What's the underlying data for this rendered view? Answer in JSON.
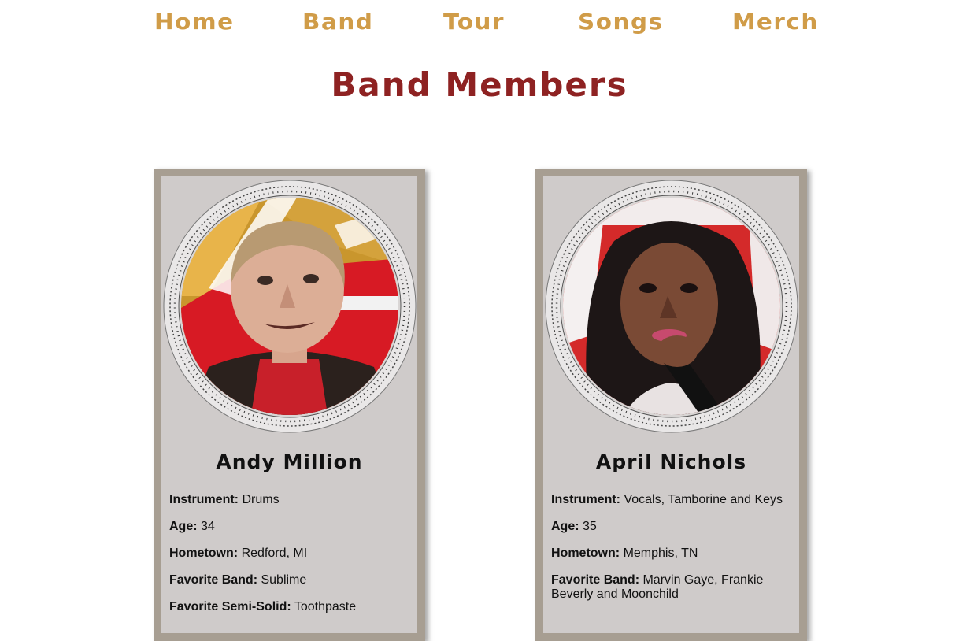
{
  "colors": {
    "nav": "#d09c48",
    "title": "#8e2222",
    "card_frame": "#a79e92",
    "card_bg": "#cfcbca"
  },
  "nav": {
    "items": [
      {
        "label": "Home"
      },
      {
        "label": "Band"
      },
      {
        "label": "Tour"
      },
      {
        "label": "Songs"
      },
      {
        "label": "Merch"
      }
    ]
  },
  "page": {
    "title": "Band Members"
  },
  "members": [
    {
      "name": "Andy Million",
      "portrait_icon": "band-member-photo",
      "facts": [
        {
          "label": "Instrument:",
          "value": "Drums"
        },
        {
          "label": "Age:",
          "value": "34"
        },
        {
          "label": "Hometown:",
          "value": "Redford, MI"
        },
        {
          "label": "Favorite Band:",
          "value": "Sublime"
        },
        {
          "label": "Favorite Semi-Solid:",
          "value": "Toothpaste"
        }
      ]
    },
    {
      "name": "April Nichols",
      "portrait_icon": "band-member-photo",
      "facts": [
        {
          "label": "Instrument:",
          "value": "Vocals, Tamborine and Keys"
        },
        {
          "label": "Age:",
          "value": "35"
        },
        {
          "label": "Hometown:",
          "value": "Memphis, TN"
        },
        {
          "label": "Favorite Band:",
          "value": "Marvin Gaye, Frankie Beverly and Moonchild"
        }
      ]
    }
  ]
}
